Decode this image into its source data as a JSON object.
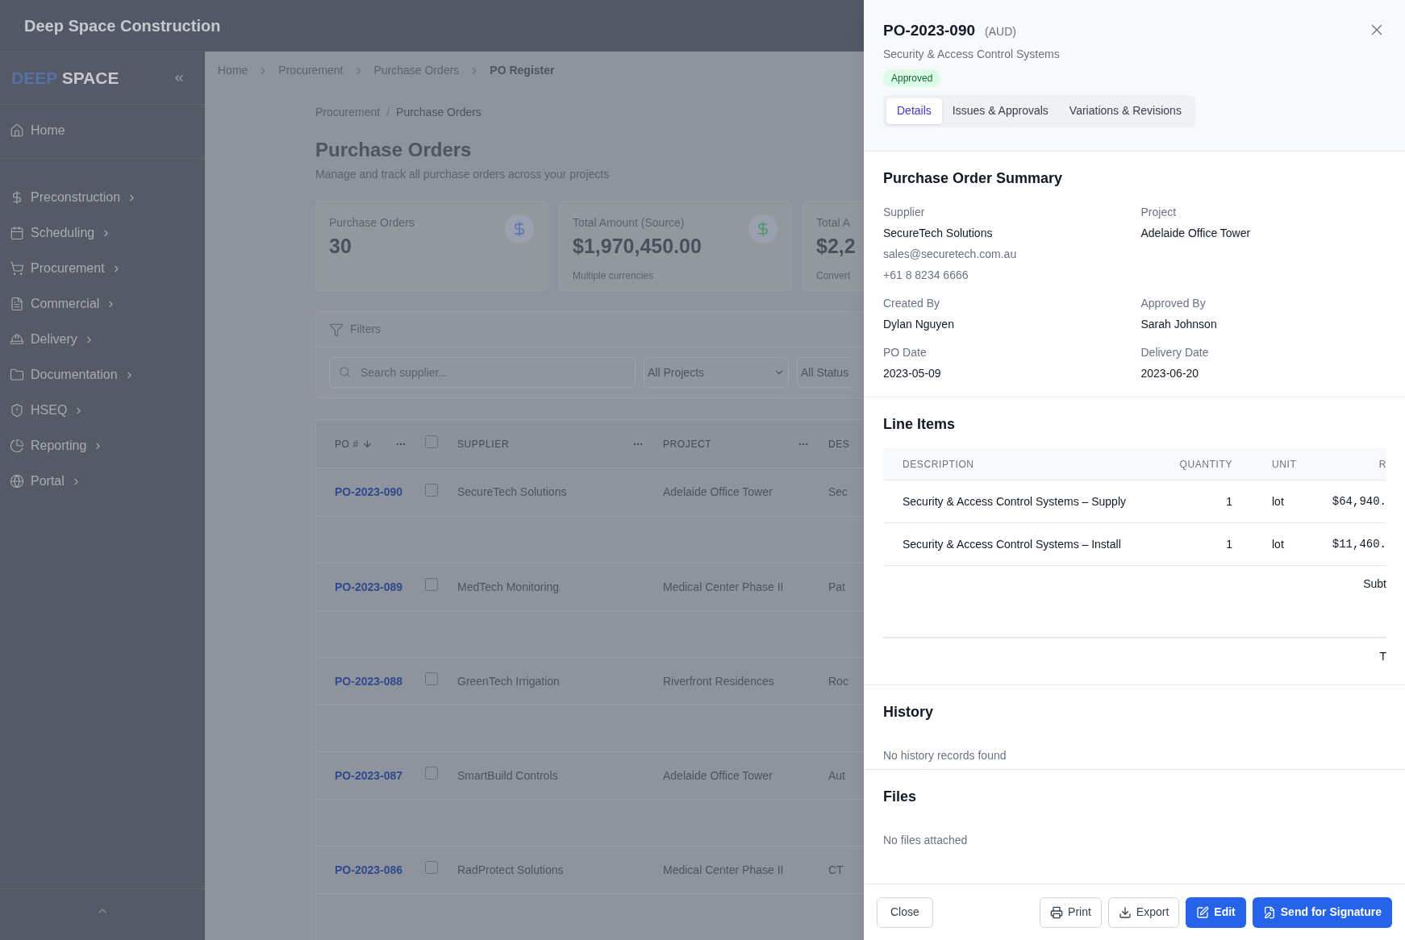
{
  "app": {
    "title": "Deep Space Construction"
  },
  "sidebar": {
    "logo": {
      "part_1": "DEEP",
      "part_2": "SPACE"
    },
    "items": [
      {
        "label": "Home",
        "expandable": false
      },
      {
        "label": "Preconstruction",
        "expandable": true
      },
      {
        "label": "Scheduling",
        "expandable": true
      },
      {
        "label": "Procurement",
        "expandable": true
      },
      {
        "label": "Commercial",
        "expandable": true
      },
      {
        "label": "Delivery",
        "expandable": true
      },
      {
        "label": "Documentation",
        "expandable": true
      },
      {
        "label": "HSEQ",
        "expandable": true
      },
      {
        "label": "Reporting",
        "expandable": true
      },
      {
        "label": "Portal",
        "expandable": true
      }
    ]
  },
  "breadcrumb": [
    {
      "label": "Home",
      "current": false
    },
    {
      "label": "Procurement",
      "current": false
    },
    {
      "label": "Purchase Orders",
      "current": false
    },
    {
      "label": "PO Register",
      "current": true
    }
  ],
  "page": {
    "breadcrumb_separator": "/",
    "breadcrumb": [
      {
        "label": "Procurement",
        "current": false
      },
      {
        "label": "Purchase Orders",
        "current": true
      }
    ],
    "title": "Purchase Orders",
    "subtitle": "Manage and track all purchase orders across your projects"
  },
  "stat_cards": [
    {
      "label": "Purchase Orders",
      "value": "30",
      "color": "#5f78b5"
    },
    {
      "label": "Total Amount (Source)",
      "value": "$1,970,450.00",
      "note": "Multiple currencies",
      "color": "#4f9a6c"
    },
    {
      "label": "Total A",
      "value": "$2,2",
      "note": "Convert"
    }
  ],
  "filters": {
    "title": "Filters",
    "search_placeholder": "Search supplier...",
    "selects": [
      "All Projects",
      "All Status"
    ]
  },
  "table": {
    "header_checked": false,
    "columns": [
      {
        "label": "PO #",
        "sorted": true
      },
      {
        "label": "SUPPLIER",
        "sorted": false
      },
      {
        "label": "PROJECT",
        "sorted": false
      },
      {
        "label": "DES",
        "sorted": false
      }
    ],
    "rows": [
      {
        "po": "PO-2023-090",
        "checked": false,
        "supplier": "SecureTech Solutions",
        "project": "Adelaide Office Tower",
        "column_4": "Sec"
      },
      {
        "po": "PO-2023-089",
        "checked": false,
        "supplier": "MedTech Monitoring",
        "project": "Medical Center Phase II",
        "column_4": "Pat"
      },
      {
        "po": "PO-2023-088",
        "checked": false,
        "supplier": "GreenTech Irrigation",
        "project": "Riverfront Residences",
        "column_4": "Roc"
      },
      {
        "po": "PO-2023-087",
        "checked": false,
        "supplier": "SmartBuild Controls",
        "project": "Adelaide Office Tower",
        "column_4": "Aut"
      },
      {
        "po": "PO-2023-086",
        "checked": false,
        "supplier": "RadProtect Solutions",
        "project": "Medical Center Phase II",
        "column_4": "CT"
      }
    ]
  },
  "drawer": {
    "title": "PO-2023-090",
    "currency": "(AUD)",
    "subtitle": "Security & Access Control Systems",
    "status": "Approved",
    "tabs": [
      {
        "label": "Details",
        "selected": true
      },
      {
        "label": "Issues & Approvals",
        "selected": false
      },
      {
        "label": "Variations & Revisions",
        "selected": false
      }
    ],
    "summary": {
      "title": "Purchase Order Summary",
      "fields": [
        {
          "label": "Supplier",
          "value": "SecureTech Solutions",
          "email": "sales@securetech.com.au",
          "phone": "+61 8 8234 6666"
        },
        {
          "label": "Project",
          "value": "Adelaide Office Tower"
        },
        {
          "label": "Created By",
          "value": "Dylan Nguyen"
        },
        {
          "label": "Approved By",
          "value": "Sarah Johnson"
        },
        {
          "label": "PO Date",
          "value": "2023-05-09"
        },
        {
          "label": "Delivery Date",
          "value": "2023-06-20"
        }
      ]
    },
    "line_items": {
      "title": "Line Items",
      "columns": [
        "DESCRIPTION",
        "QUANTITY",
        "UNIT",
        "R"
      ],
      "rows": [
        {
          "description": "Security & Access Control Systems – Supply",
          "quantity": "1",
          "unit": "lot",
          "rate": "$64,940."
        },
        {
          "description": "Security & Access Control Systems – Install",
          "quantity": "1",
          "unit": "lot",
          "rate": "$11,460."
        }
      ],
      "subtotal_label": "Subt",
      "total_label": "T"
    },
    "history": {
      "title": "History",
      "empty": "No history records found"
    },
    "files": {
      "title": "Files",
      "empty": "No files attached"
    },
    "buttons": [
      {
        "label": "Close",
        "kind": "plain"
      },
      {
        "label": "Print",
        "kind": "outline"
      },
      {
        "label": "Export",
        "kind": "outline"
      },
      {
        "label": "Edit",
        "kind": "primary"
      },
      {
        "label": "Send for Signature",
        "kind": "primary"
      }
    ]
  }
}
